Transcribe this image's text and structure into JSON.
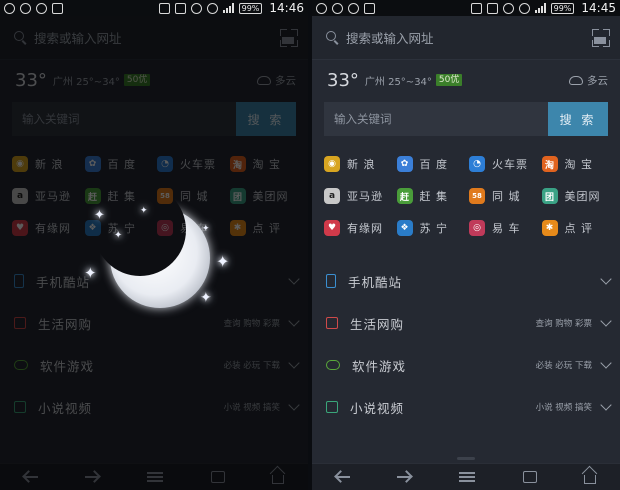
{
  "status": {
    "left_time": "14:46",
    "right_time": "14:45",
    "battery": "99%"
  },
  "search": {
    "placeholder": "搜索或输入网址"
  },
  "weather": {
    "temp": "33°",
    "city_range": "广州 25°~34°",
    "aqi": "50优",
    "condition": "多云"
  },
  "keyword": {
    "placeholder": "输入关键词",
    "button": "搜 索"
  },
  "sites": [
    {
      "label": "新 浪",
      "glyph": "◉",
      "color": "#d8a521",
      "icon": "sina-icon"
    },
    {
      "label": "百 度",
      "glyph": "✿",
      "color": "#3b7fd8",
      "icon": "baidu-icon"
    },
    {
      "label": "火车票",
      "glyph": "◔",
      "color": "#2d7ed6",
      "icon": "train-icon"
    },
    {
      "label": "淘 宝",
      "glyph": "淘",
      "color": "#e0631f",
      "icon": "taobao-icon"
    },
    {
      "label": "亚马逊",
      "glyph": "a",
      "color": "#c8c8c8",
      "icon": "amazon-icon"
    },
    {
      "label": "赶 集",
      "glyph": "赶",
      "color": "#4a9d3a",
      "icon": "ganji-icon"
    },
    {
      "label": "同 城",
      "glyph": "58",
      "color": "#e07a1d",
      "icon": "tongcheng-icon"
    },
    {
      "label": "美团网",
      "glyph": "团",
      "color": "#3aa285",
      "icon": "meituan-icon"
    },
    {
      "label": "有缘网",
      "glyph": "♥",
      "color": "#d03a4a",
      "icon": "youyuan-icon"
    },
    {
      "label": "苏 宁",
      "glyph": "❖",
      "color": "#2a7cc8",
      "icon": "suning-icon"
    },
    {
      "label": "易 车",
      "glyph": "◎",
      "color": "#c03a5a",
      "icon": "yiche-icon"
    },
    {
      "label": "点 评",
      "glyph": "✱",
      "color": "#e68a1a",
      "icon": "dianping-icon"
    }
  ],
  "categories": [
    {
      "label": "手机酷站",
      "tags": "",
      "color": "#3b8fd0"
    },
    {
      "label": "生活网购",
      "tags": "查询 购物 彩票",
      "color": "#cf4a4a"
    },
    {
      "label": "软件游戏",
      "tags": "必装 必玩 下载",
      "color": "#59a83a"
    },
    {
      "label": "小说视频",
      "tags": "小说 视频 搞笑",
      "color": "#3aa67a"
    }
  ],
  "colors": {
    "background": "#252932",
    "accent_button": "#3d86ac",
    "aqi_badge": "#3b7f2a"
  }
}
